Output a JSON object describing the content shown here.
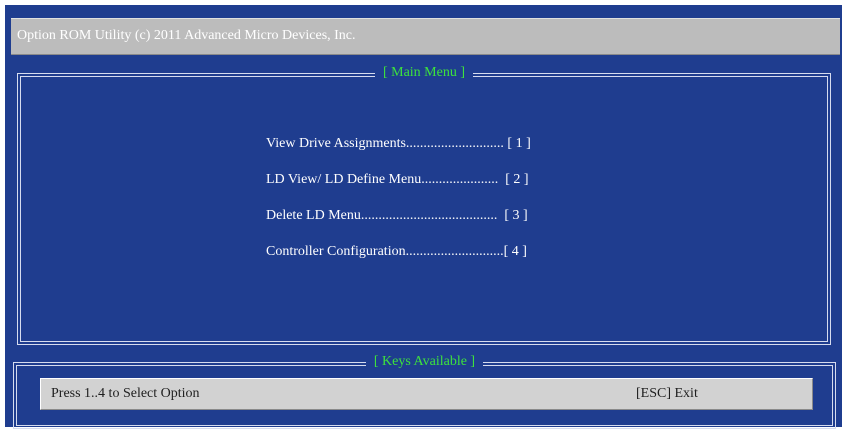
{
  "title_bar": {
    "text": "Option ROM Utility (c) 2011 Advanced Micro Devices, Inc."
  },
  "main_menu": {
    "caption": "[ Main Menu ]",
    "items": [
      {
        "label": "View Drive Assignments............................ [ 1 ]"
      },
      {
        "label": "LD View/ LD Define Menu......................  [ 2 ]"
      },
      {
        "label": "Delete LD Menu.......................................  [ 3 ]"
      },
      {
        "label": "Controller Configuration............................[ 4 ]"
      }
    ]
  },
  "keys_panel": {
    "caption": "[ Keys Available ]",
    "hint": "Press 1..4 to Select Option",
    "exit_label": "[ESC] Exit"
  },
  "colors": {
    "background": "#1f3d8f",
    "caption_text": "#3de23d",
    "title_bar": "#bcbcbc",
    "status_bar": "#d2d2d2"
  }
}
